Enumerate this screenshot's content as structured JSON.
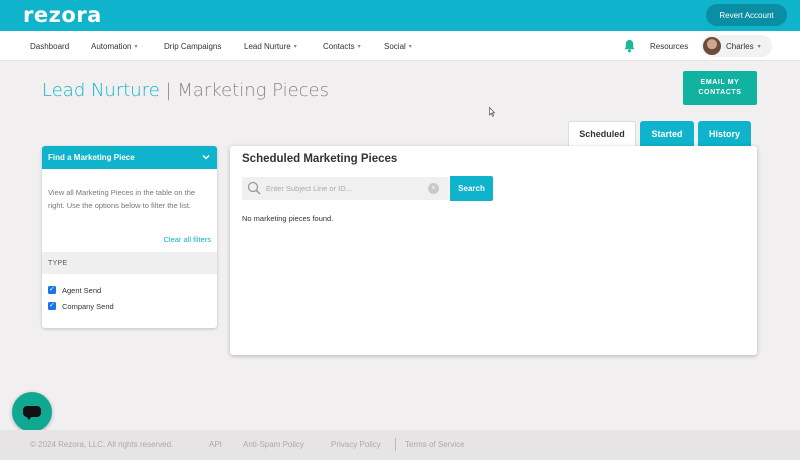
{
  "app": {
    "logo": "rezora",
    "revert_label": "Revert Account"
  },
  "nav": {
    "items": [
      {
        "label": "Dashboard",
        "dropdown": false
      },
      {
        "label": "Automation",
        "dropdown": true
      },
      {
        "label": "Drip Campaigns",
        "dropdown": false
      },
      {
        "label": "Lead Nurture",
        "dropdown": true
      },
      {
        "label": "Contacts",
        "dropdown": true
      },
      {
        "label": "Social",
        "dropdown": true
      }
    ],
    "resources": "Resources",
    "user_name": "Charles",
    "dropdown_glyph": "▾"
  },
  "header": {
    "title": "Lead Nurture",
    "separator": " | ",
    "subtitle": "Marketing Pieces",
    "email_button": "EMAIL MY CONTACTS"
  },
  "tabs": [
    {
      "label": "Scheduled",
      "active": true
    },
    {
      "label": "Started",
      "active": false
    },
    {
      "label": "History",
      "active": false
    }
  ],
  "filter": {
    "title": "Find a Marketing Piece",
    "description": "View all Marketing Pieces in the table on the right. Use the options below to filter the list.",
    "clear_label": "Clear all filters",
    "type_label": "TYPE",
    "options": [
      {
        "label": "Agent Send",
        "checked": true
      },
      {
        "label": "Company Send",
        "checked": true
      }
    ]
  },
  "main": {
    "title": "Scheduled Marketing Pieces",
    "search_placeholder": "Enter Subject Line or ID...",
    "search_value": "",
    "search_button": "Search",
    "empty_message": "No marketing pieces found."
  },
  "footer": {
    "copyright": "© 2024 Rezora, LLC. All rights reserved.",
    "links": [
      "API",
      "Anti-Spam Policy",
      "Privacy Policy",
      "Terms of Service"
    ]
  },
  "colors": {
    "brand": "#0fb3cb",
    "accent_green": "#11b3a0",
    "chat": "#11a893"
  }
}
